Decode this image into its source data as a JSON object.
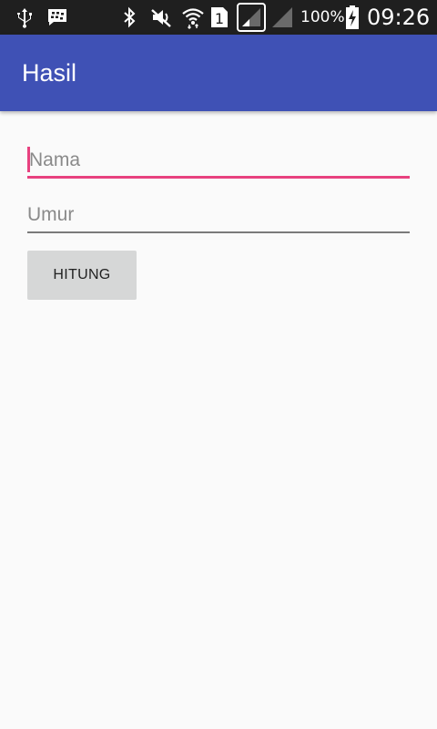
{
  "status_bar": {
    "battery_percent": "100%",
    "time": "09:26",
    "sim_slot": "1",
    "icons": [
      "usb-icon",
      "bbm-icon",
      "bluetooth-icon",
      "mute-icon",
      "wifi-icon",
      "sim-icon",
      "signal-icon",
      "signal-icon",
      "battery-charging-icon"
    ]
  },
  "app_bar": {
    "title": "Hasil",
    "color": "#3f51b5"
  },
  "form": {
    "nama": {
      "placeholder": "Nama",
      "value": "",
      "focused": true
    },
    "umur": {
      "placeholder": "Umur",
      "value": ""
    },
    "button_label": "HITUNG"
  },
  "colors": {
    "accent": "#e8417f",
    "background": "#fafafa",
    "status_bar": "#1f1f1f",
    "button": "#d6d7d7"
  }
}
